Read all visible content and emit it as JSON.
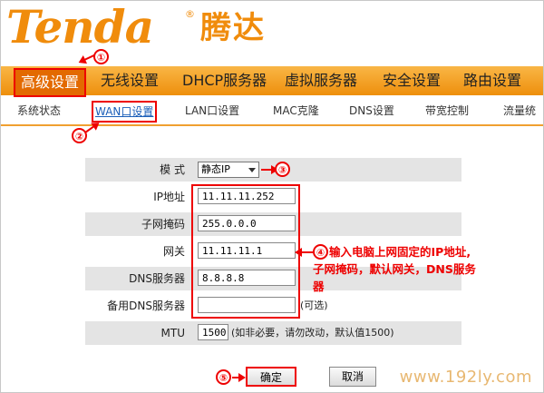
{
  "brand": {
    "logo": "Tenda",
    "reg": "®",
    "cn": "腾达"
  },
  "main_nav": [
    {
      "label": "高级设置",
      "active": true
    },
    {
      "label": "无线设置"
    },
    {
      "label": "DHCP服务器"
    },
    {
      "label": "虚拟服务器"
    },
    {
      "label": "安全设置"
    },
    {
      "label": "路由设置"
    }
  ],
  "sub_nav": [
    {
      "label": "系统状态"
    },
    {
      "label": "WAN口设置",
      "active": true
    },
    {
      "label": "LAN口设置"
    },
    {
      "label": "MAC克隆"
    },
    {
      "label": "DNS设置"
    },
    {
      "label": "带宽控制"
    },
    {
      "label": "流量统"
    }
  ],
  "form": {
    "mode_label": "模 式",
    "mode_value": "静态IP",
    "ip_label": "IP地址",
    "ip_value": "11.11.11.252",
    "mask_label": "子网掩码",
    "mask_value": "255.0.0.0",
    "gateway_label": "网关",
    "gateway_value": "11.11.11.1",
    "dns_label": "DNS服务器",
    "dns_value": "8.8.8.8",
    "dns2_label": "备用DNS服务器",
    "dns2_value": "",
    "dns2_hint": "(可选)",
    "mtu_label": "MTU",
    "mtu_value": "1500",
    "mtu_hint": "(如非必要，请勿改动，默认值1500)"
  },
  "buttons": {
    "ok": "确定",
    "cancel": "取消"
  },
  "annotations": {
    "n1": "①",
    "n2": "②",
    "n3": "③",
    "n4": "④",
    "n5": "⑤",
    "note4_line1": "输入电脑上网固定的IP地址,",
    "note4_line2": "子网掩码，默认网关，DNS服务",
    "note4_line3": "器"
  },
  "watermark": "www.192ly.com",
  "colors": {
    "orange": "#f08c0c",
    "nav": "#f5a623",
    "red": "#e00000",
    "link": "#1a5eb8"
  }
}
